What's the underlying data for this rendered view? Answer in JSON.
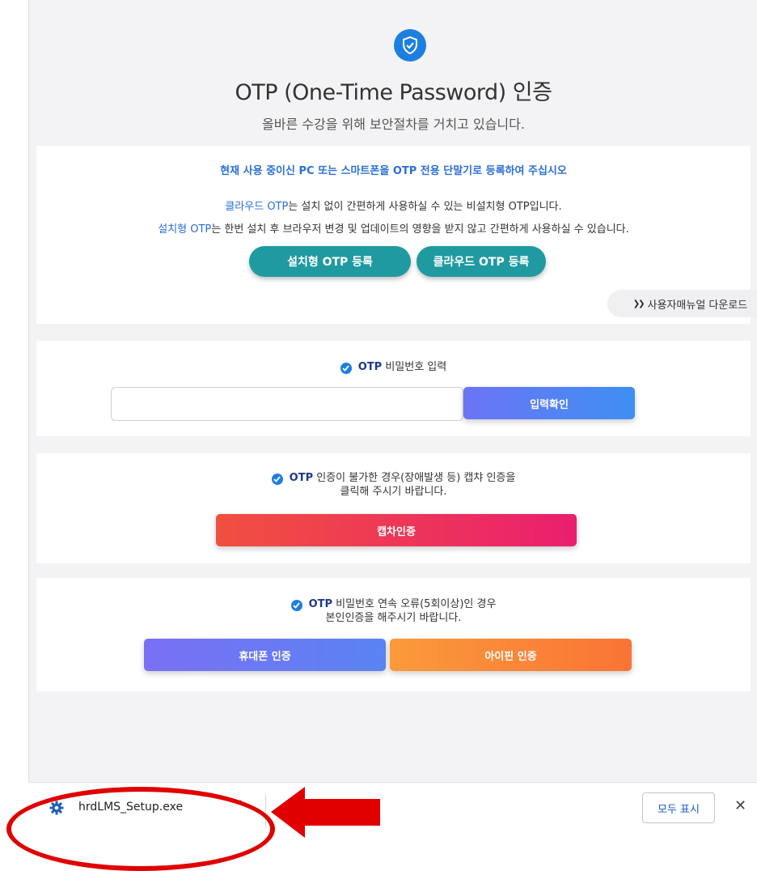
{
  "header": {
    "title": "OTP (One-Time Password) 인증",
    "subtitle": "올바른 수강을 위해 보안절차를 거치고 있습니다."
  },
  "register": {
    "headline": "현재 사용 중이신 PC 또는 스마트폰을 OTP 전용 단말기로 등록하여 주십시오",
    "cloud_term": "클라우드 OTP",
    "cloud_desc": "는 설치 없이 간편하게 사용하실 수 있는 비설치형 OTP입니다.",
    "install_term": "설치형 OTP",
    "install_desc": "는 한번 설치 후 브라우저 변경 및 업데이트의 영향을 받지 않고 간편하게 사용하실 수 있습니다.",
    "install_button": "설치형 OTP 등록",
    "cloud_button": "클라우드 OTP 등록",
    "manual_button": "사용자매뉴얼 다운로드",
    "manual_arrow": "❯❯"
  },
  "otp_entry": {
    "otp_word": "OTP",
    "label": " 비밀번호 입력",
    "input_value": "",
    "confirm_button": "입력확인"
  },
  "captcha": {
    "otp_word": "OTP",
    "line1": " 인증이 불가한 경우(장애발생 등) 캡챠 인증을",
    "line2": "클릭해 주시기 바랍니다.",
    "button": "캡차인증"
  },
  "identity": {
    "otp_word": "OTP",
    "line1": " 비밀번호 연속 오류(5회이상)인 경우",
    "line2": "본인인증을 해주시기 바랍니다.",
    "phone_button": "휴대폰 인증",
    "ipin_button": "아이핀 인증"
  },
  "download_bar": {
    "file_name": "hrdLMS_Setup.exe",
    "caret": "^",
    "show_all": "모두 표시",
    "close": "✕"
  },
  "colors": {
    "accent_blue": "#1d7fe0",
    "teal": "#1f9aa1",
    "annotation_red": "#e00000"
  }
}
